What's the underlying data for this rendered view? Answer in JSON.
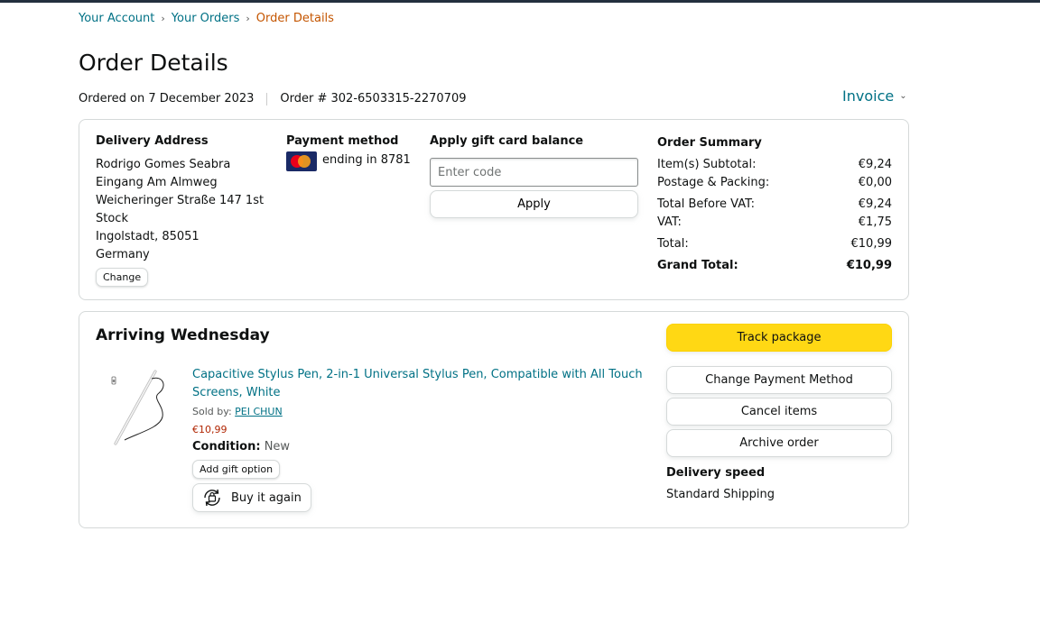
{
  "breadcrumb": {
    "items": [
      "Your Account",
      "Your Orders"
    ],
    "current": "Order Details",
    "separator": "›"
  },
  "page": {
    "title": "Order Details",
    "ordered_on": "Ordered on 7 December 2023",
    "order_number": "Order # 302-6503315-2270709",
    "invoice_label": "Invoice"
  },
  "delivery": {
    "title": "Delivery Address",
    "lines": [
      "Rodrigo Gomes Seabra",
      "Eingang Am Almweg",
      "Weicheringer Straße 147 1st Stock",
      "Ingolstadt, 85051",
      "Germany"
    ],
    "change_label": "Change"
  },
  "payment": {
    "title": "Payment method",
    "card_text": "ending in 8781",
    "card_icon": "mastercard-icon"
  },
  "gift_card": {
    "title": "Apply gift card balance",
    "placeholder": "Enter code",
    "value": "",
    "apply_label": "Apply"
  },
  "summary": {
    "title": "Order Summary",
    "rows": [
      {
        "label": "Item(s) Subtotal:",
        "value": "€9,24"
      },
      {
        "label": "Postage & Packing:",
        "value": "€0,00"
      },
      {
        "label": "Total Before VAT:",
        "value": "€9,24"
      },
      {
        "label": "VAT:",
        "value": "€1,75"
      },
      {
        "label": "Total:",
        "value": "€10,99"
      }
    ],
    "grand_total_label": "Grand Total:",
    "grand_total_value": "€10,99"
  },
  "shipment": {
    "status": "Arriving Wednesday",
    "product": {
      "title": "Capacitive Stylus Pen, 2-in-1 Universal Stylus Pen, Compatible with All Touch Screens, White",
      "sold_by_label": "Sold by:",
      "seller": "PEI CHUN",
      "price": "€10,99",
      "condition_label": "Condition:",
      "condition_value": "New",
      "gift_option_label": "Add gift option",
      "buy_again_label": "Buy it again",
      "image_icon": "stylus-pen-icon"
    },
    "actions": {
      "track": "Track package",
      "change_payment": "Change Payment Method",
      "cancel": "Cancel items",
      "archive": "Archive order"
    },
    "delivery_speed_title": "Delivery speed",
    "delivery_speed_value": "Standard Shipping"
  },
  "colors": {
    "link": "#007185",
    "current_crumb": "#c45500",
    "price": "#b12704",
    "track_button": "#ffd814",
    "border": "#d5d9d9"
  }
}
